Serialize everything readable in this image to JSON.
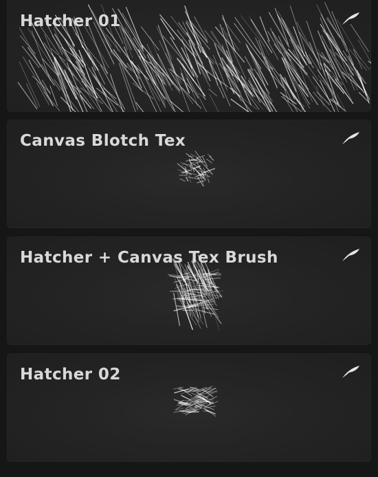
{
  "brush_library": {
    "brushes": [
      {
        "name": "Hatcher 01",
        "icon": "procreate-brush-icon"
      },
      {
        "name": "Canvas Blotch Tex",
        "icon": "procreate-brush-icon"
      },
      {
        "name": "Hatcher + Canvas Tex Brush",
        "icon": "procreate-brush-icon"
      },
      {
        "name": "Hatcher 02",
        "icon": "procreate-brush-icon"
      }
    ]
  },
  "colors": {
    "background": "#161616",
    "card": "#242424",
    "title": "#d9d9d9",
    "stroke": "#ffffff"
  }
}
